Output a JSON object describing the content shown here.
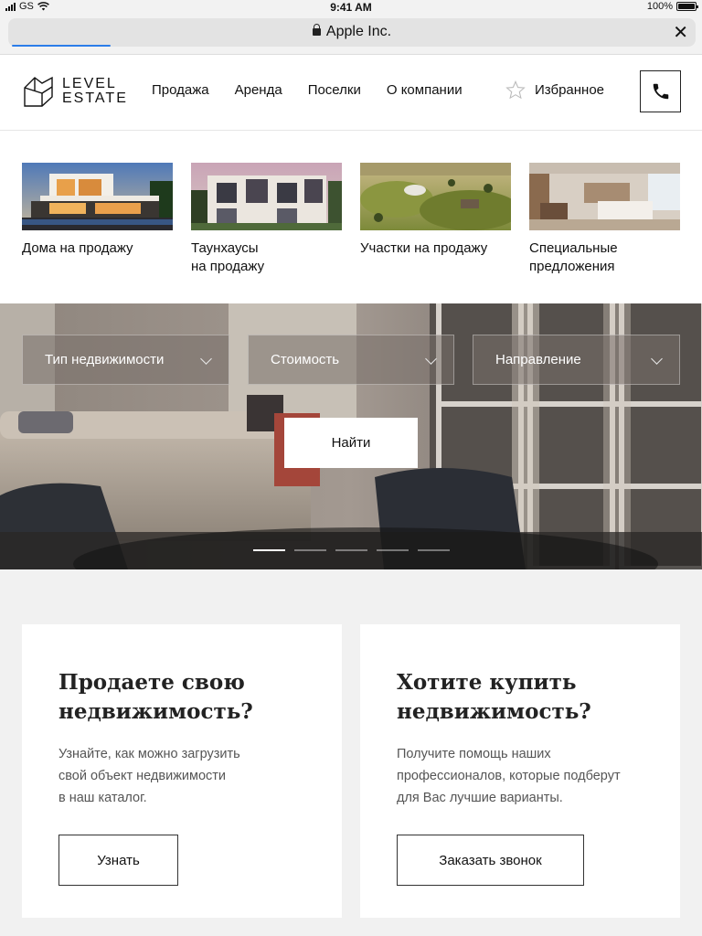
{
  "status_bar": {
    "carrier": "GS",
    "time": "9:41 AM",
    "battery": "100%",
    "battery_level": 1.0
  },
  "browser": {
    "site_name": "Apple Inc.",
    "close_icon": "close-icon",
    "lock_icon": "lock-icon"
  },
  "header": {
    "logo_line1": "LEVEL",
    "logo_line2": "ESTATE",
    "nav": [
      "Продажа",
      "Аренда",
      "Поселки",
      "О компании"
    ],
    "favorites": "Избранное",
    "phone_icon": "phone-icon"
  },
  "categories": [
    {
      "label": "Дома на продажу"
    },
    {
      "label": "Таунхаусы\nна продажу"
    },
    {
      "label": "Участки на продажу"
    },
    {
      "label": "Специальные\nпредложения"
    }
  ],
  "hero": {
    "filters": [
      "Тип недвижимости",
      "Стоимость",
      "Направление"
    ],
    "search_button": "Найти",
    "slides_count": 5,
    "active_slide": 1
  },
  "cards": [
    {
      "title": "Продаете свою\nнедвижимость?",
      "text": "Узнайте, как можно загрузить\nсвой объект недвижимости\nв наш каталог.",
      "button": "Узнать"
    },
    {
      "title": "Хотите купить\nнедвижимость?",
      "text": "Получите помощь наших\nпрофессионалов, которые подберут\nдля Вас лучшие варианты.",
      "button": "Заказать звонок"
    }
  ]
}
